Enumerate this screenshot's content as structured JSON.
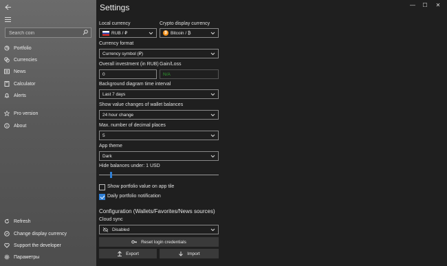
{
  "sidebar": {
    "search_placeholder": "Search coin",
    "nav_top": [
      {
        "label": "Portfolio",
        "icon": "portfolio-icon"
      },
      {
        "label": "Currencies",
        "icon": "currencies-icon"
      },
      {
        "label": "News",
        "icon": "news-icon"
      },
      {
        "label": "Calculator",
        "icon": "calculator-icon"
      },
      {
        "label": "Alerts",
        "icon": "alerts-icon"
      },
      {
        "label": "Pro version",
        "icon": "star-icon"
      },
      {
        "label": "About",
        "icon": "info-icon"
      }
    ],
    "nav_bottom": [
      {
        "label": "Refresh",
        "icon": "refresh-icon"
      },
      {
        "label": "Change display currency",
        "icon": "currency-icon"
      },
      {
        "label": "Support the developer",
        "icon": "heart-icon"
      },
      {
        "label": "Параметры",
        "icon": "gear-icon"
      }
    ]
  },
  "main": {
    "title": "Settings",
    "local_currency": {
      "label": "Local currency",
      "value": "RUB / ₽"
    },
    "crypto_currency": {
      "label": "Crypto display currency",
      "value": "Bitcoin / ₿",
      "coin_symbol": "₿"
    },
    "currency_format": {
      "label": "Currency format",
      "value": "Currency symbol (₽)"
    },
    "overall_investment": {
      "label": "Overall investment (in RUB)",
      "value": "0"
    },
    "gain_loss": {
      "label": "Gain/Loss",
      "value": "N/A"
    },
    "bg_interval": {
      "label": "Background diagram time interval",
      "value": "Last 7 days"
    },
    "wallet_changes": {
      "label": "Show value changes of wallet balances",
      "value": "24 hour change"
    },
    "decimal_places": {
      "label": "Max. number of decimal places",
      "value": "5"
    },
    "app_theme": {
      "label": "App theme",
      "value": "Dark"
    },
    "hide_balances": {
      "label": "Hide balances under: 1 USD",
      "slider_fraction": 0.1
    },
    "show_tile": {
      "label": "Show portfolio value on app tile",
      "checked": false
    },
    "daily_notification": {
      "label": "Daily portfolio notification",
      "checked": true
    },
    "configuration_title": "Configuration (Wallets/Favorites/News sources)",
    "cloud_sync": {
      "label": "Cloud sync",
      "value": "Disabled"
    },
    "reset_label": "Reset login credentials",
    "export_label": "Export",
    "import_label": "Import"
  },
  "colors": {
    "accent": "#2f7fd6",
    "sidebar_bg": "#5f5f5f",
    "main_bg": "#1f1f1f",
    "gain_text": "#2f9e2f"
  }
}
